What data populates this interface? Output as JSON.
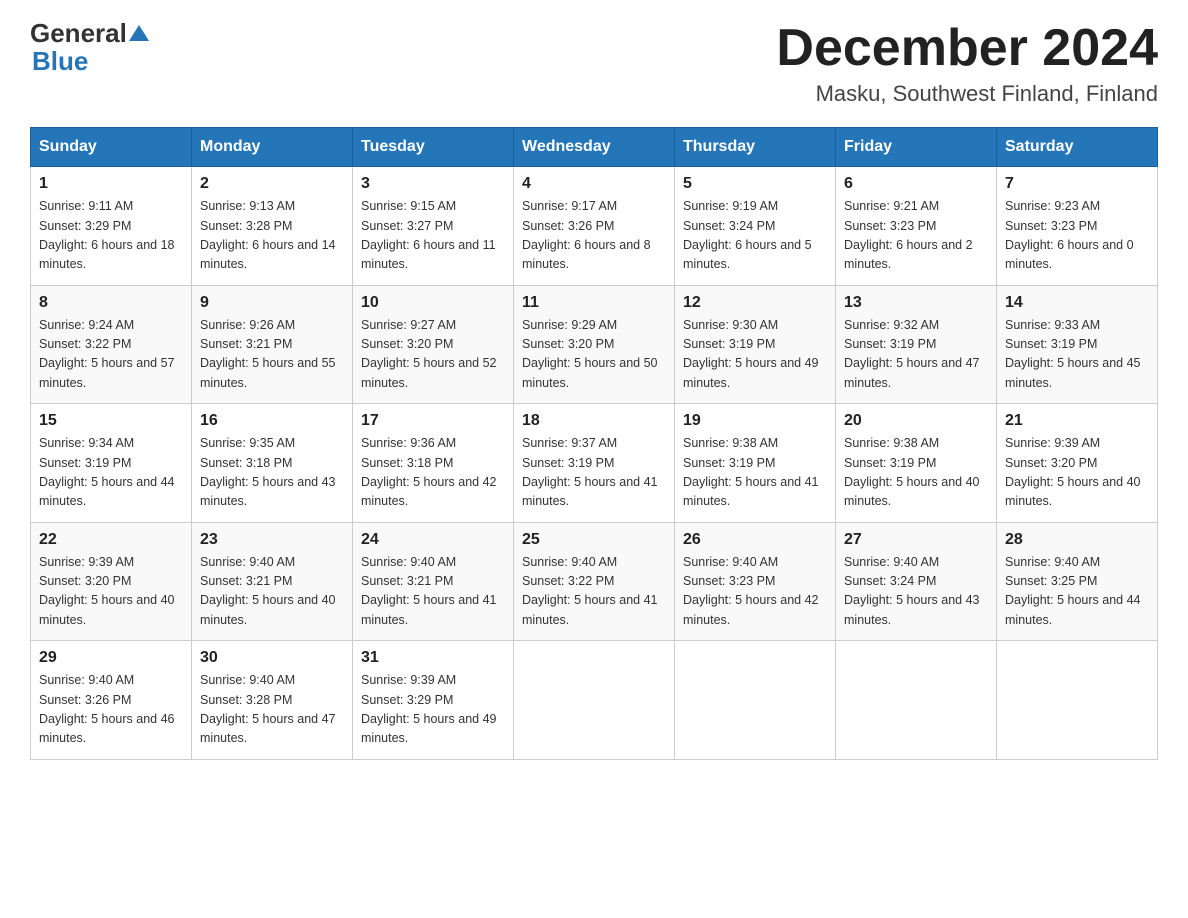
{
  "header": {
    "logo_general": "General",
    "logo_blue": "Blue",
    "month_title": "December 2024",
    "location": "Masku, Southwest Finland, Finland"
  },
  "weekdays": [
    "Sunday",
    "Monday",
    "Tuesday",
    "Wednesday",
    "Thursday",
    "Friday",
    "Saturday"
  ],
  "weeks": [
    [
      {
        "day": "1",
        "sunrise": "9:11 AM",
        "sunset": "3:29 PM",
        "daylight": "6 hours and 18 minutes."
      },
      {
        "day": "2",
        "sunrise": "9:13 AM",
        "sunset": "3:28 PM",
        "daylight": "6 hours and 14 minutes."
      },
      {
        "day": "3",
        "sunrise": "9:15 AM",
        "sunset": "3:27 PM",
        "daylight": "6 hours and 11 minutes."
      },
      {
        "day": "4",
        "sunrise": "9:17 AM",
        "sunset": "3:26 PM",
        "daylight": "6 hours and 8 minutes."
      },
      {
        "day": "5",
        "sunrise": "9:19 AM",
        "sunset": "3:24 PM",
        "daylight": "6 hours and 5 minutes."
      },
      {
        "day": "6",
        "sunrise": "9:21 AM",
        "sunset": "3:23 PM",
        "daylight": "6 hours and 2 minutes."
      },
      {
        "day": "7",
        "sunrise": "9:23 AM",
        "sunset": "3:23 PM",
        "daylight": "6 hours and 0 minutes."
      }
    ],
    [
      {
        "day": "8",
        "sunrise": "9:24 AM",
        "sunset": "3:22 PM",
        "daylight": "5 hours and 57 minutes."
      },
      {
        "day": "9",
        "sunrise": "9:26 AM",
        "sunset": "3:21 PM",
        "daylight": "5 hours and 55 minutes."
      },
      {
        "day": "10",
        "sunrise": "9:27 AM",
        "sunset": "3:20 PM",
        "daylight": "5 hours and 52 minutes."
      },
      {
        "day": "11",
        "sunrise": "9:29 AM",
        "sunset": "3:20 PM",
        "daylight": "5 hours and 50 minutes."
      },
      {
        "day": "12",
        "sunrise": "9:30 AM",
        "sunset": "3:19 PM",
        "daylight": "5 hours and 49 minutes."
      },
      {
        "day": "13",
        "sunrise": "9:32 AM",
        "sunset": "3:19 PM",
        "daylight": "5 hours and 47 minutes."
      },
      {
        "day": "14",
        "sunrise": "9:33 AM",
        "sunset": "3:19 PM",
        "daylight": "5 hours and 45 minutes."
      }
    ],
    [
      {
        "day": "15",
        "sunrise": "9:34 AM",
        "sunset": "3:19 PM",
        "daylight": "5 hours and 44 minutes."
      },
      {
        "day": "16",
        "sunrise": "9:35 AM",
        "sunset": "3:18 PM",
        "daylight": "5 hours and 43 minutes."
      },
      {
        "day": "17",
        "sunrise": "9:36 AM",
        "sunset": "3:18 PM",
        "daylight": "5 hours and 42 minutes."
      },
      {
        "day": "18",
        "sunrise": "9:37 AM",
        "sunset": "3:19 PM",
        "daylight": "5 hours and 41 minutes."
      },
      {
        "day": "19",
        "sunrise": "9:38 AM",
        "sunset": "3:19 PM",
        "daylight": "5 hours and 41 minutes."
      },
      {
        "day": "20",
        "sunrise": "9:38 AM",
        "sunset": "3:19 PM",
        "daylight": "5 hours and 40 minutes."
      },
      {
        "day": "21",
        "sunrise": "9:39 AM",
        "sunset": "3:20 PM",
        "daylight": "5 hours and 40 minutes."
      }
    ],
    [
      {
        "day": "22",
        "sunrise": "9:39 AM",
        "sunset": "3:20 PM",
        "daylight": "5 hours and 40 minutes."
      },
      {
        "day": "23",
        "sunrise": "9:40 AM",
        "sunset": "3:21 PM",
        "daylight": "5 hours and 40 minutes."
      },
      {
        "day": "24",
        "sunrise": "9:40 AM",
        "sunset": "3:21 PM",
        "daylight": "5 hours and 41 minutes."
      },
      {
        "day": "25",
        "sunrise": "9:40 AM",
        "sunset": "3:22 PM",
        "daylight": "5 hours and 41 minutes."
      },
      {
        "day": "26",
        "sunrise": "9:40 AM",
        "sunset": "3:23 PM",
        "daylight": "5 hours and 42 minutes."
      },
      {
        "day": "27",
        "sunrise": "9:40 AM",
        "sunset": "3:24 PM",
        "daylight": "5 hours and 43 minutes."
      },
      {
        "day": "28",
        "sunrise": "9:40 AM",
        "sunset": "3:25 PM",
        "daylight": "5 hours and 44 minutes."
      }
    ],
    [
      {
        "day": "29",
        "sunrise": "9:40 AM",
        "sunset": "3:26 PM",
        "daylight": "5 hours and 46 minutes."
      },
      {
        "day": "30",
        "sunrise": "9:40 AM",
        "sunset": "3:28 PM",
        "daylight": "5 hours and 47 minutes."
      },
      {
        "day": "31",
        "sunrise": "9:39 AM",
        "sunset": "3:29 PM",
        "daylight": "5 hours and 49 minutes."
      },
      null,
      null,
      null,
      null
    ]
  ]
}
